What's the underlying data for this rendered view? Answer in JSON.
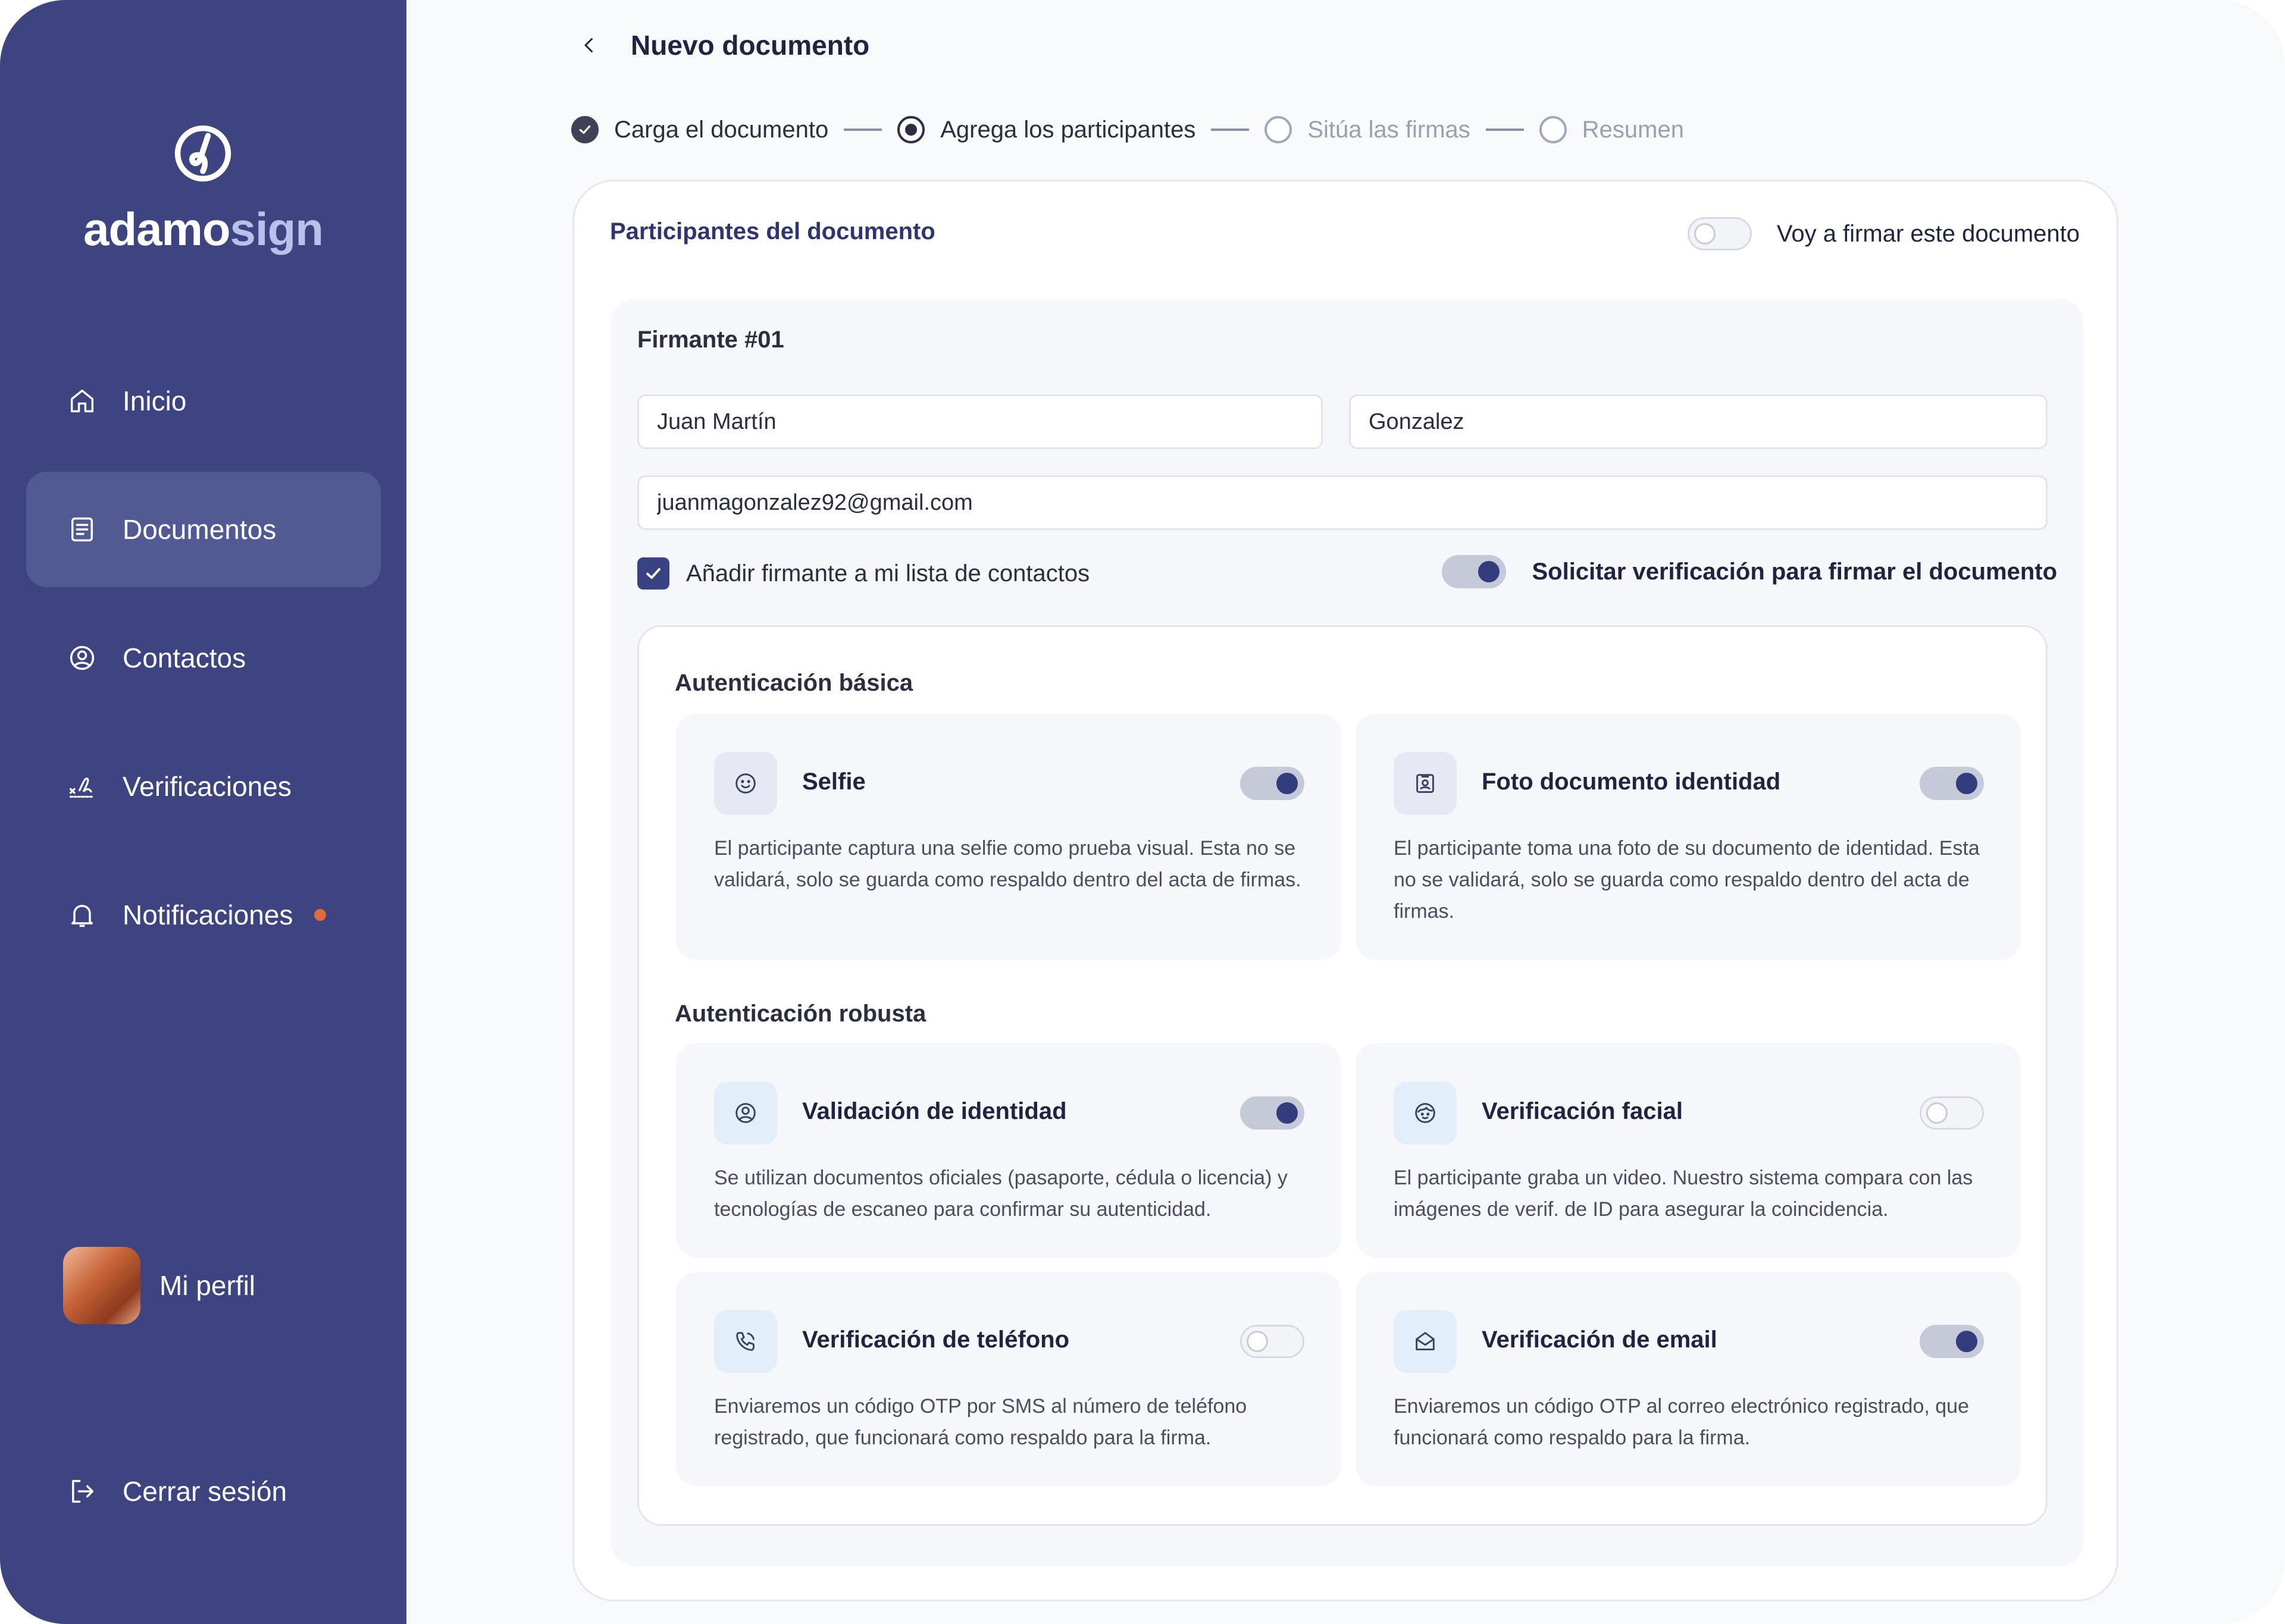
{
  "sidebar": {
    "brand_primary": "adamo",
    "brand_secondary": "sign",
    "items": [
      {
        "label": "Inicio",
        "icon": "home-icon"
      },
      {
        "label": "Documentos",
        "icon": "document-icon",
        "active": true
      },
      {
        "label": "Contactos",
        "icon": "user-circle-icon"
      },
      {
        "label": "Verificaciones",
        "icon": "signature-icon"
      },
      {
        "label": "Notificaciones",
        "icon": "bell-icon",
        "has_badge": true
      }
    ],
    "profile_label": "Mi perfil",
    "logout_label": "Cerrar sesión"
  },
  "header": {
    "title": "Nuevo documento"
  },
  "stepper": {
    "steps": [
      {
        "label": "Carga el documento",
        "state": "done"
      },
      {
        "label": "Agrega los participantes",
        "state": "current"
      },
      {
        "label": "Sitúa las firmas",
        "state": "pending"
      },
      {
        "label": "Resumen",
        "state": "pending"
      }
    ]
  },
  "participants": {
    "title": "Participantes del documento",
    "self_sign_label": "Voy a firmar este documento",
    "self_sign_on": false,
    "signer": {
      "title": "Firmante #01",
      "first_name": "Juan Martín",
      "last_name": "Gonzalez",
      "email": "juanmagonzalez92@gmail.com",
      "add_contact_label": "Añadir firmante a mi lista de contactos",
      "add_contact_checked": true,
      "verify_label": "Solicitar verificación para firmar el documento",
      "verify_on": true
    }
  },
  "auth": {
    "basic_title": "Autenticación básica",
    "robust_title": "Autenticación robusta",
    "basic": [
      {
        "title": "Selfie",
        "icon": "smile-face-icon",
        "enabled": true,
        "description": "El participante captura una selfie como prueba visual. Esta no se validará, solo se guarda como respaldo dentro del acta de firmas."
      },
      {
        "title": "Foto documento identidad",
        "icon": "id-photo-icon",
        "enabled": true,
        "description": "El participante toma una foto de su documento de identidad. Esta no se validará, solo se guarda como respaldo dentro del acta de firmas."
      }
    ],
    "robust": [
      {
        "title": "Validación de identidad",
        "icon": "user-circle-icon",
        "enabled": true,
        "description": "Se utilizan documentos oficiales (pasaporte, cédula o licencia) y tecnologías de escaneo para confirmar su autenticidad."
      },
      {
        "title": "Verificación facial",
        "icon": "face-scan-icon",
        "enabled": false,
        "description": "El participante graba un video. Nuestro sistema compara con las imágenes de verif. de ID para asegurar la coincidencia."
      },
      {
        "title": "Verificación de teléfono",
        "icon": "phone-icon",
        "enabled": false,
        "description": "Enviaremos un código OTP por SMS al número de teléfono registrado, que funcionará como respaldo para la firma."
      },
      {
        "title": "Verificación de email",
        "icon": "envelope-icon",
        "enabled": true,
        "description": "Enviaremos un código OTP al correo electrónico registrado, que funcionará como respaldo para la firma."
      }
    ]
  },
  "colors": {
    "sidebar_bg": "#3d4480",
    "sidebar_active": "#525a93",
    "accent": "#333c7d",
    "notification_dot": "#e06b3a"
  }
}
